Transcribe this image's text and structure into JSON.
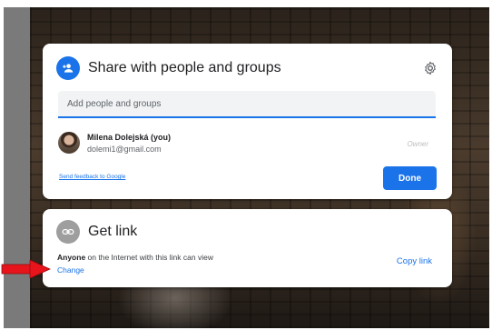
{
  "share_dialog": {
    "title": "Share with people and groups",
    "add_placeholder": "Add people and groups",
    "person": {
      "name": "Milena Dolejská (you)",
      "email": "dolemi1@gmail.com",
      "role": "Owner"
    },
    "feedback_link": "Send feedback to Google",
    "done_label": "Done"
  },
  "link_dialog": {
    "title": "Get link",
    "access_strong": "Anyone",
    "access_rest": " on the Internet with this link can view",
    "change_label": "Change",
    "copy_label": "Copy link"
  },
  "colors": {
    "accent": "#1a73e8",
    "arrow": "#e8141c"
  },
  "icons": {
    "share": "person-add-icon",
    "settings": "gear-icon",
    "link": "link-icon",
    "annotation": "red-arrow-icon"
  }
}
